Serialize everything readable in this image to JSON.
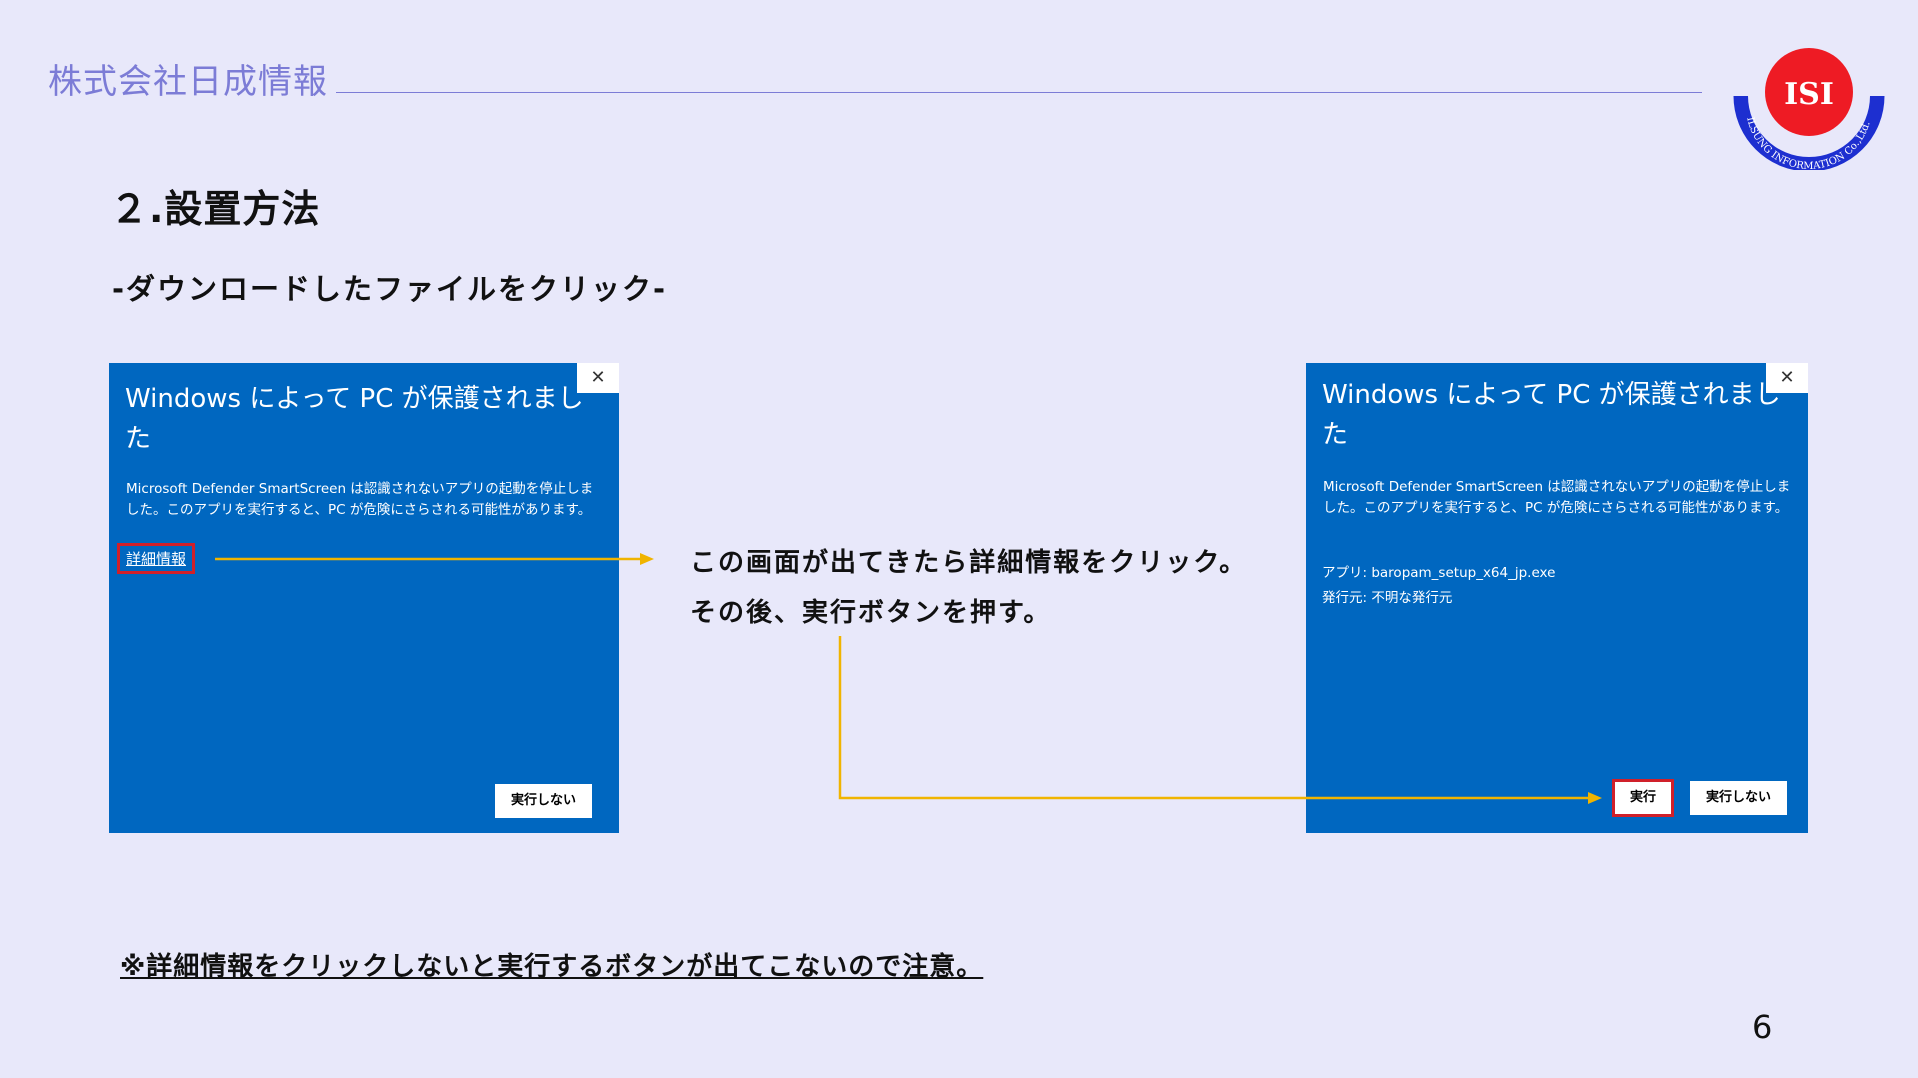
{
  "header": {
    "company": "株式会社日成情報",
    "logo_text": "ISI",
    "logo_ring_text": "ILSUNG INFORMATION Co.,Ltd."
  },
  "section_title": "２.設置方法",
  "subtitle": "-ダウンロードしたファイルをクリック-",
  "dialog_left": {
    "close": "✕",
    "title": "Windows によって PC が保護されました",
    "body": "Microsoft Defender SmartScreen は認識されないアプリの起動を停止しました。このアプリを実行すると、PC が危険にさらされる可能性があります。",
    "more_info": "詳細情報",
    "dont_run": "実行しない"
  },
  "dialog_right": {
    "close": "✕",
    "title": "Windows によって PC が保護されました",
    "body": "Microsoft Defender SmartScreen は認識されないアプリの起動を停止しました。このアプリを実行すると、PC が危険にさらされる可能性があります。",
    "app_line": "アプリ:  baropam_setup_x64_jp.exe",
    "publisher_line": "発行元:  不明な発行元",
    "run": "実行",
    "dont_run": "実行しない"
  },
  "instructions": {
    "line1": "この画面が出てきたら詳細情報をクリック。",
    "line2": "その後、実行ボタンを押す。"
  },
  "note": "※詳細情報をクリックしないと実行するボタンが出てこないので注意。",
  "page_number": "6",
  "colors": {
    "background": "#e8e8fa",
    "dialog_blue": "#0067c0",
    "accent_text": "#7c7cd6",
    "arrow": "#f0b400",
    "highlight_red": "#d0202a"
  }
}
